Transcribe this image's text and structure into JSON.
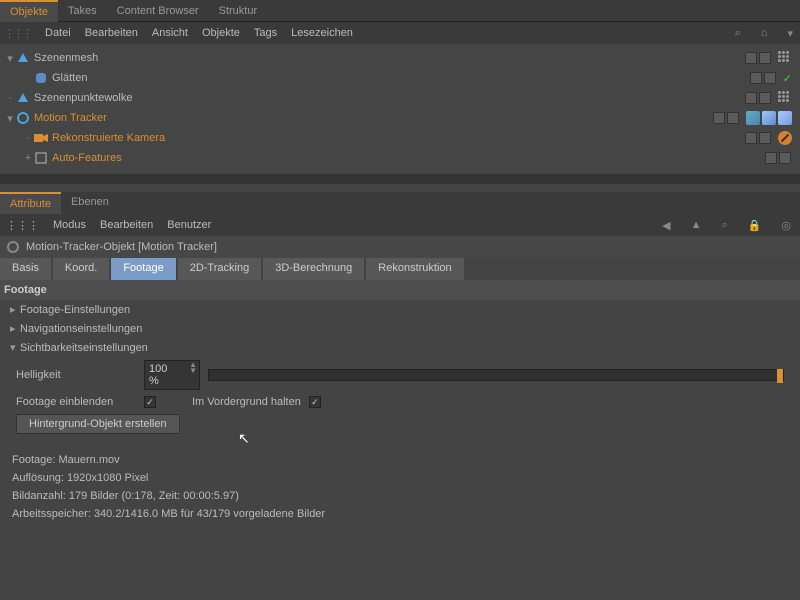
{
  "topTabs": {
    "objekte": "Objekte",
    "takes": "Takes",
    "cb": "Content Browser",
    "struktur": "Struktur"
  },
  "menu": {
    "datei": "Datei",
    "bearbeiten": "Bearbeiten",
    "ansicht": "Ansicht",
    "objekte": "Objekte",
    "tags": "Tags",
    "lesezeichen": "Lesezeichen"
  },
  "tree": {
    "szenenmesh": "Szenenmesh",
    "glaetten": "Glätten",
    "punktewolke": "Szenenpunktewolke",
    "motiontracker": "Motion Tracker",
    "kamera": "Rekonstruierte Kamera",
    "autofeat": "Auto-Features"
  },
  "panelTabs": {
    "attr": "Attribute",
    "ebenen": "Ebenen"
  },
  "attrMenu": {
    "modus": "Modus",
    "bearbeiten": "Bearbeiten",
    "benutzer": "Benutzer"
  },
  "objTitle": "Motion-Tracker-Objekt [Motion Tracker]",
  "subTabs": {
    "basis": "Basis",
    "koord": "Koord.",
    "footage": "Footage",
    "track2d": "2D-Tracking",
    "berech3d": "3D-Berechnung",
    "rekon": "Rekonstruktion"
  },
  "sectionTitle": "Footage",
  "groups": {
    "einstellungen": "Footage-Einstellungen",
    "nav": "Navigationseinstellungen",
    "sicht": "Sichtbarkeitseinstellungen"
  },
  "fields": {
    "helligkeit_lbl": "Helligkeit",
    "helligkeit_val": "100 %",
    "einblenden_lbl": "Footage einblenden",
    "vordergrund_lbl": "Im Vordergrund halten",
    "hintergrund_btn": "Hintergrund-Objekt erstellen"
  },
  "info": {
    "l1": "Footage: Mauern.mov",
    "l2": "Auflösung: 1920x1080 Pixel",
    "l3": "Bildanzahl: 179 Bilder (0:178, Zeit: 00:00:5.97)",
    "l4": "Arbeitsspeicher: 340.2/1416.0 MB für 43/179 vorgeladene Bilder"
  }
}
